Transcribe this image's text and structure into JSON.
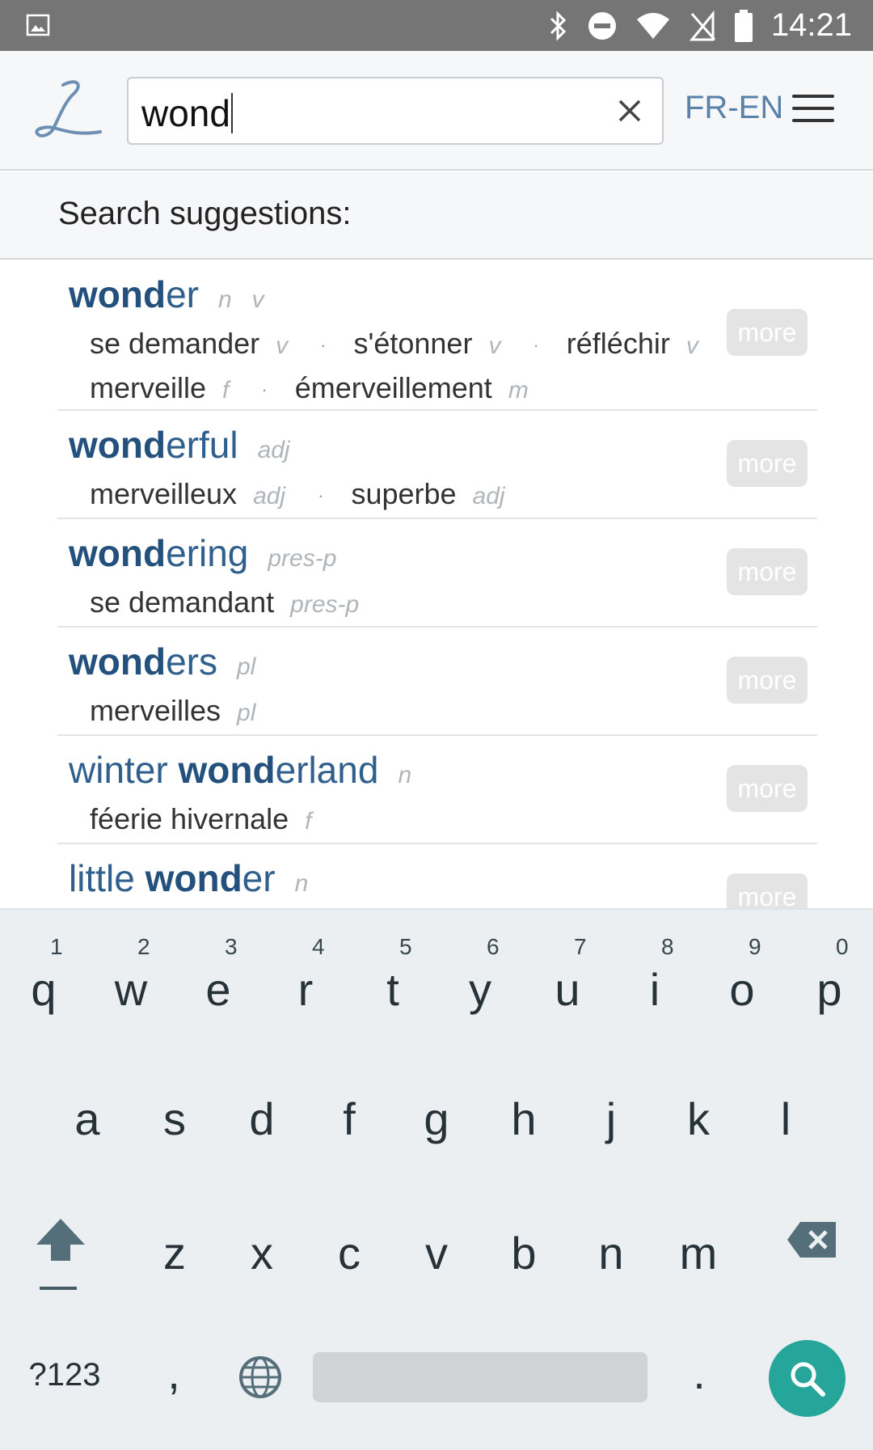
{
  "status_bar": {
    "time": "14:21",
    "icons": [
      "image-icon",
      "bluetooth-icon",
      "do-not-disturb-icon",
      "wifi-icon",
      "no-signal-icon",
      "battery-icon"
    ]
  },
  "header": {
    "logo_letter": "L",
    "search": {
      "value": "wond"
    },
    "language_pair": "FR-EN",
    "menu_icon": "hamburger-menu-icon",
    "clear_icon": "close-icon"
  },
  "suggestions": {
    "heading": "Search suggestions:",
    "more_label": "more",
    "entries": [
      {
        "pre": "",
        "hl": "wond",
        "post": "er",
        "pos": "n   v",
        "lines": [
          [
            {
              "w": "se demander",
              "pos": "v"
            },
            {
              "w": "s'étonner",
              "pos": "v"
            },
            {
              "w": "réfléchir",
              "pos": "v"
            }
          ],
          [
            {
              "w": "merveille",
              "pos": "f"
            },
            {
              "w": "émerveillement",
              "pos": "m"
            }
          ]
        ]
      },
      {
        "pre": "",
        "hl": "wond",
        "post": "erful",
        "pos": "adj",
        "lines": [
          [
            {
              "w": "merveilleux",
              "pos": "adj"
            },
            {
              "w": "superbe",
              "pos": "adj"
            }
          ]
        ]
      },
      {
        "pre": "",
        "hl": "wond",
        "post": "ering",
        "pos": "pres-p",
        "lines": [
          [
            {
              "w": "se demandant",
              "pos": "pres-p"
            }
          ]
        ]
      },
      {
        "pre": "",
        "hl": "wond",
        "post": "ers",
        "pos": "pl",
        "lines": [
          [
            {
              "w": "merveilles",
              "pos": "pl"
            }
          ]
        ]
      },
      {
        "pre": "winter ",
        "hl": "wond",
        "post": "erland",
        "pos": "n",
        "lines": [
          [
            {
              "w": "féerie hivernale",
              "pos": "f"
            }
          ]
        ]
      },
      {
        "pre": "little ",
        "hl": "wond",
        "post": "er",
        "pos": "n",
        "lines": []
      }
    ]
  },
  "keyboard": {
    "row1": [
      "q",
      "w",
      "e",
      "r",
      "t",
      "y",
      "u",
      "i",
      "o",
      "p"
    ],
    "row1_hints": [
      "1",
      "2",
      "3",
      "4",
      "5",
      "6",
      "7",
      "8",
      "9",
      "0"
    ],
    "row2": [
      "a",
      "s",
      "d",
      "f",
      "g",
      "h",
      "j",
      "k",
      "l"
    ],
    "row3": [
      "z",
      "x",
      "c",
      "v",
      "b",
      "n",
      "m"
    ],
    "symbols_key": "?123",
    "comma_key": ",",
    "period_key": ".",
    "icons": [
      "shift-icon",
      "backspace-icon",
      "globe-icon",
      "search-icon"
    ],
    "accent_color": "#26a69a"
  }
}
